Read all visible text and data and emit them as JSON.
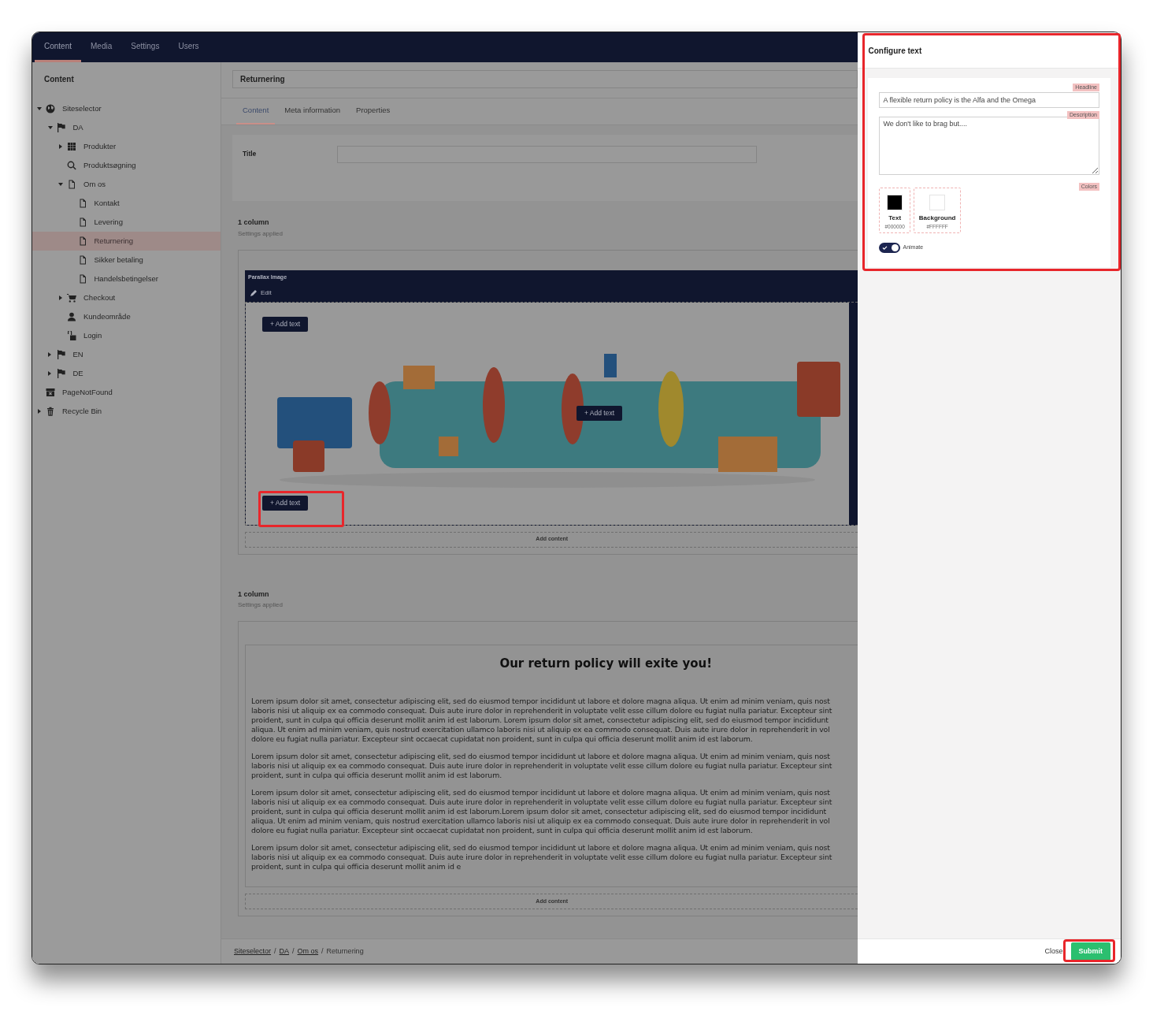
{
  "top_nav": [
    {
      "label": "Content",
      "selected": true
    },
    {
      "label": "Media",
      "selected": false
    },
    {
      "label": "Settings",
      "selected": false
    },
    {
      "label": "Users",
      "selected": false
    }
  ],
  "sidebar": {
    "title": "Content",
    "tree": [
      {
        "label": "Siteselector",
        "kind": "site",
        "expanded": true,
        "selected": false,
        "children": [
          {
            "label": "DA",
            "kind": "language",
            "expanded": true,
            "selected": false,
            "children": [
              {
                "label": "Produkter",
                "kind": "catalog",
                "expanded": false,
                "selected": false
              },
              {
                "label": "Produktsøgning",
                "kind": "search",
                "selected": false
              },
              {
                "label": "Om os",
                "kind": "page",
                "expanded": true,
                "selected": false,
                "children": [
                  {
                    "label": "Kontakt",
                    "kind": "page",
                    "selected": false
                  },
                  {
                    "label": "Levering",
                    "kind": "page",
                    "selected": false
                  },
                  {
                    "label": "Returnering",
                    "kind": "page",
                    "selected": true
                  },
                  {
                    "label": "Sikker betaling",
                    "kind": "page",
                    "selected": false
                  },
                  {
                    "label": "Handelsbetingelser",
                    "kind": "page",
                    "selected": false
                  }
                ]
              },
              {
                "label": "Checkout",
                "kind": "checkout",
                "expanded": false,
                "selected": false
              },
              {
                "label": "Kundeområde",
                "kind": "account",
                "selected": false
              },
              {
                "label": "Login",
                "kind": "login",
                "selected": false
              }
            ]
          },
          {
            "label": "EN",
            "kind": "language",
            "expanded": false,
            "selected": false
          },
          {
            "label": "DE",
            "kind": "language",
            "expanded": false,
            "selected": false
          }
        ]
      },
      {
        "label": "PageNotFound",
        "kind": "error-page",
        "selected": false
      },
      {
        "label": "Recycle Bin",
        "kind": "recycle-bin",
        "expanded": false,
        "selected": false
      }
    ]
  },
  "page_name": "Returnering",
  "tabs": [
    {
      "label": "Content",
      "selected": true
    },
    {
      "label": "Meta information",
      "selected": false
    },
    {
      "label": "Properties",
      "selected": false
    }
  ],
  "title_field": {
    "label": "Title"
  },
  "sections": [
    {
      "heading": "1 column",
      "subheading": "Settings applied",
      "block_title": "Parallax Image",
      "edit_label": "Edit",
      "add_text_buttons": [
        "+ Add text",
        "+ Add text",
        "+ Add text"
      ],
      "add_content": "Add content"
    },
    {
      "kind": "text",
      "heading": "1 column",
      "subheading": "Settings applied",
      "title": "Our return policy will exite you!",
      "paragraphs": [
        {
          "lines": [
            "Lorem ipsum dolor sit amet, consectetur adipiscing elit, sed do eiusmod tempor incididunt ut labore et dolore magna aliqua. Ut enim ad minim veniam, quis nost",
            "laboris nisi ut aliquip ex ea commodo consequat. Duis aute irure dolor in reprehenderit in voluptate velit esse cillum dolore eu fugiat nulla pariatur. Excepteur sint",
            "proident, sunt in culpa qui officia deserunt mollit anim id est laborum. Lorem ipsum dolor sit amet, consectetur adipiscing elit, sed do eiusmod tempor incididunt",
            "aliqua. Ut enim ad minim veniam, quis nostrud exercitation ullamco laboris nisi ut aliquip ex ea commodo consequat. Duis aute irure dolor in reprehenderit in vol",
            "dolore eu fugiat nulla pariatur. Excepteur sint occaecat cupidatat non proident, sunt in culpa qui officia deserunt mollit anim id est laborum."
          ]
        },
        {
          "lines": [
            "Lorem ipsum dolor sit amet, consectetur adipiscing elit, sed do eiusmod tempor incididunt ut labore et dolore magna aliqua. Ut enim ad minim veniam, quis nost",
            "laboris nisi ut aliquip ex ea commodo consequat. Duis aute irure dolor in reprehenderit in voluptate velit esse cillum dolore eu fugiat nulla pariatur. Excepteur sint",
            "proident, sunt in culpa qui officia deserunt mollit anim id est laborum."
          ]
        },
        {
          "lines": [
            "Lorem ipsum dolor sit amet, consectetur adipiscing elit, sed do eiusmod tempor incididunt ut labore et dolore magna aliqua. Ut enim ad minim veniam, quis nost",
            "laboris nisi ut aliquip ex ea commodo consequat. Duis aute irure dolor in reprehenderit in voluptate velit esse cillum dolore eu fugiat nulla pariatur. Excepteur sint",
            "proident, sunt in culpa qui officia deserunt mollit anim id est laborum.Lorem ipsum dolor sit amet, consectetur adipiscing elit, sed do eiusmod tempor incididunt",
            "aliqua. Ut enim ad minim veniam, quis nostrud exercitation ullamco laboris nisi ut aliquip ex ea commodo consequat. Duis aute irure dolor in reprehenderit in vol",
            "dolore eu fugiat nulla pariatur. Excepteur sint occaecat cupidatat non proident, sunt in culpa qui officia deserunt mollit anim id est laborum."
          ]
        },
        {
          "lines": [
            "Lorem ipsum dolor sit amet, consectetur adipiscing elit, sed do eiusmod tempor incididunt ut labore et dolore magna aliqua. Ut enim ad minim veniam, quis nost",
            "laboris nisi ut aliquip ex ea commodo consequat. Duis aute irure dolor in reprehenderit in voluptate velit esse cillum dolore eu fugiat nulla pariatur. Excepteur sint",
            "proident, sunt in culpa qui officia deserunt mollit anim id e"
          ]
        }
      ],
      "add_content": "Add content"
    }
  ],
  "breadcrumb": [
    {
      "label": "Siteselector",
      "link": true
    },
    {
      "label": "DA",
      "link": true
    },
    {
      "label": "Om os",
      "link": true
    },
    {
      "label": "Returnering",
      "link": false
    }
  ],
  "breadcrumb_separator": "/",
  "panel": {
    "title": "Configure text",
    "headline": {
      "label": "Headline",
      "value": "A flexible return policy is the Alfa and the Omega"
    },
    "description": {
      "label": "Description",
      "value": "We don't like to brag but...."
    },
    "colors_label": "Colors",
    "colors": [
      {
        "label": "Text",
        "value": "#000000",
        "color": "#000000"
      },
      {
        "label": "Background",
        "value": "#FFFFFF",
        "color": "#ffffff"
      }
    ],
    "animate": {
      "label": "Animate",
      "on": true
    },
    "close": "Close",
    "submit": "Submit"
  }
}
